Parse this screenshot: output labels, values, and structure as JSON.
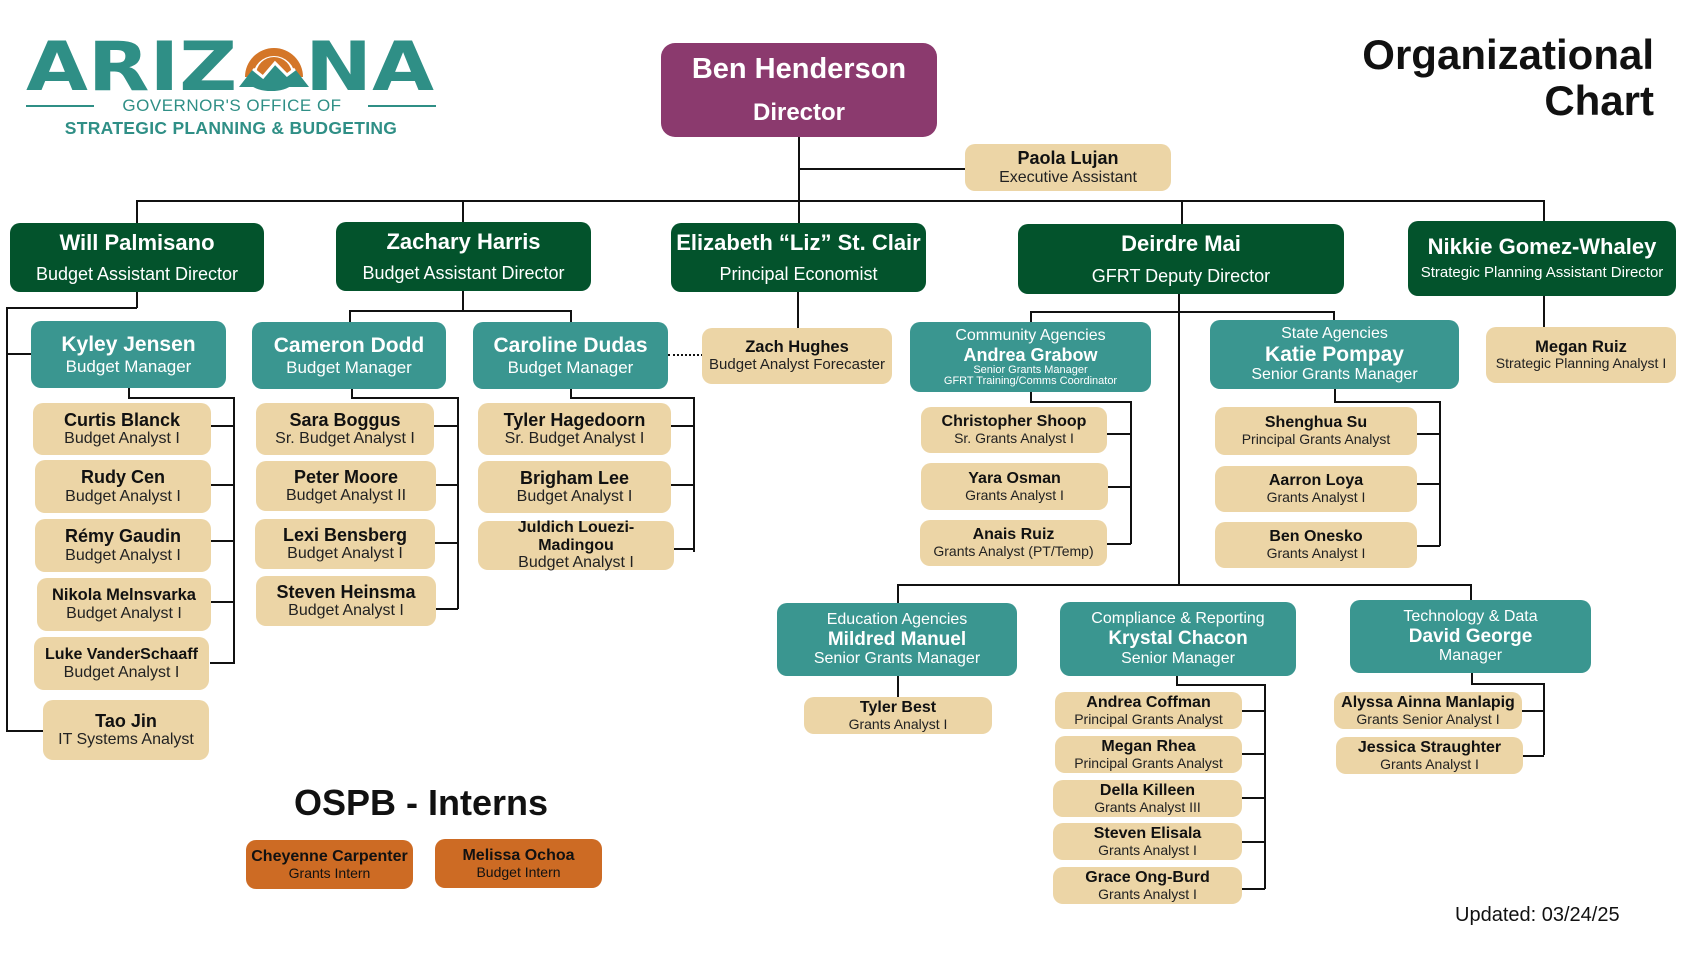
{
  "logo": {
    "word": "ARIZONA",
    "sub1": "GOVERNOR'S OFFICE OF",
    "sub2": "STRATEGIC PLANNING & BUDGETING"
  },
  "title": {
    "line1": "Organizational",
    "line2": "Chart"
  },
  "director": {
    "name": "Ben Henderson",
    "title": "Director"
  },
  "exec_assistant": {
    "name": "Paola Lujan",
    "title": "Executive Assistant"
  },
  "leaders": [
    {
      "name": "Will Palmisano",
      "title": "Budget Assistant Director"
    },
    {
      "name": "Zachary Harris",
      "title": "Budget Assistant Director"
    },
    {
      "name": "Elizabeth “Liz” St. Clair",
      "title": "Principal Economist"
    },
    {
      "name": "Deirdre Mai",
      "title": "GFRT Deputy Director"
    },
    {
      "name": "Nikkie Gomez-Whaley",
      "title": "Strategic Planning Assistant Director"
    }
  ],
  "will_team": {
    "manager": {
      "name": "Kyley Jensen",
      "title": "Budget Manager"
    },
    "staff": [
      {
        "name": "Curtis Blanck",
        "title": "Budget Analyst I"
      },
      {
        "name": "Rudy Cen",
        "title": "Budget Analyst I"
      },
      {
        "name": "Rémy Gaudin",
        "title": "Budget Analyst I"
      },
      {
        "name": "Nikola Melnsvarka",
        "title": "Budget Analyst I"
      },
      {
        "name": "Luke VanderSchaaff",
        "title": "Budget Analyst I"
      }
    ],
    "direct": {
      "name": "Tao Jin",
      "title": "IT Systems Analyst"
    }
  },
  "zach_team": [
    {
      "manager": {
        "name": "Cameron Dodd",
        "title": "Budget Manager"
      },
      "staff": [
        {
          "name": "Sara Boggus",
          "title": "Sr. Budget Analyst I"
        },
        {
          "name": "Peter Moore",
          "title": "Budget Analyst II"
        },
        {
          "name": "Lexi Bensberg",
          "title": "Budget Analyst I"
        },
        {
          "name": "Steven Heinsma",
          "title": "Budget Analyst I"
        }
      ]
    },
    {
      "manager": {
        "name": "Caroline Dudas",
        "title": "Budget Manager"
      },
      "staff": [
        {
          "name": "Tyler Hagedoorn",
          "title": "Sr. Budget Analyst I"
        },
        {
          "name": "Brigham Lee",
          "title": "Budget Analyst I"
        },
        {
          "name": "Juldich Louezi-Madingou",
          "title": "Budget Analyst I"
        }
      ]
    }
  ],
  "liz_team": {
    "name": "Zach Hughes",
    "title": "Budget Analyst Forecaster"
  },
  "deirdre_team": [
    {
      "division": "Community Agencies",
      "manager": {
        "name": "Andrea Grabow",
        "title": "Senior Grants Manager",
        "title2": "GFRT Training/Comms Coordinator"
      },
      "staff": [
        {
          "name": "Christopher Shoop",
          "title": "Sr. Grants Analyst I"
        },
        {
          "name": "Yara Osman",
          "title": "Grants Analyst I"
        },
        {
          "name": "Anais Ruiz",
          "title": "Grants Analyst (PT/Temp)"
        }
      ]
    },
    {
      "division": "State Agencies",
      "manager": {
        "name": "Katie Pompay",
        "title": "Senior Grants Manager"
      },
      "staff": [
        {
          "name": "Shenghua Su",
          "title": "Principal Grants Analyst"
        },
        {
          "name": "Aarron Loya",
          "title": "Grants Analyst I"
        },
        {
          "name": "Ben Onesko",
          "title": "Grants Analyst I"
        }
      ]
    },
    {
      "division": "Education Agencies",
      "manager": {
        "name": "Mildred Manuel",
        "title": "Senior Grants Manager"
      },
      "staff": [
        {
          "name": "Tyler Best",
          "title": "Grants Analyst I"
        }
      ]
    },
    {
      "division": "Compliance & Reporting",
      "manager": {
        "name": "Krystal Chacon",
        "title": "Senior Manager"
      },
      "staff": [
        {
          "name": "Andrea Coffman",
          "title": "Principal Grants Analyst"
        },
        {
          "name": "Megan Rhea",
          "title": "Principal Grants Analyst"
        },
        {
          "name": "Della Killeen",
          "title": "Grants Analyst III"
        },
        {
          "name": "Steven Elisala",
          "title": "Grants Analyst I"
        },
        {
          "name": "Grace Ong-Burd",
          "title": "Grants Analyst I"
        }
      ]
    },
    {
      "division": "Technology & Data",
      "manager": {
        "name": "David George",
        "title": "Manager"
      },
      "staff": [
        {
          "name": "Alyssa Ainna Manlapig",
          "title": "Grants Senior Analyst I"
        },
        {
          "name": "Jessica Straughter",
          "title": "Grants Analyst I"
        }
      ]
    }
  ],
  "nikkie_team": {
    "name": "Megan Ruiz",
    "title": "Strategic Planning Analyst I"
  },
  "interns": {
    "heading": "OSPB - Interns",
    "people": [
      {
        "name": "Cheyenne Carpenter",
        "title": "Grants Intern"
      },
      {
        "name": "Melissa Ochoa",
        "title": "Budget Intern"
      }
    ]
  },
  "updated": "Updated: 03/24/25",
  "colors": {
    "director": "#8b3a6e",
    "leader": "#03532c",
    "manager": "#3a9690",
    "staff": "#ecd5a6",
    "intern": "#cd6b24",
    "logo_teal": "#2f8f86",
    "logo_orange": "#d47628"
  }
}
